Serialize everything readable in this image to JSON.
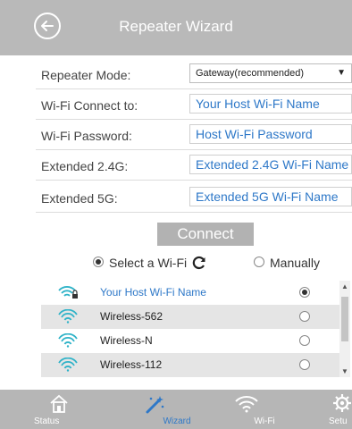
{
  "header": {
    "title": "Repeater Wizard"
  },
  "form": {
    "repeater_mode_label": "Repeater Mode:",
    "repeater_mode_value": "Gateway(recommended)",
    "wifi_connect_label": "Wi-Fi Connect to:",
    "wifi_connect_value": "Your Host Wi-Fi Name",
    "wifi_password_label": "Wi-Fi Password:",
    "wifi_password_value": "Host Wi-Fi Password",
    "ext24_label": "Extended 2.4G:",
    "ext24_value": "Extended 2.4G Wi-Fi Name",
    "ext5_label": "Extended 5G:",
    "ext5_value": "Extended 5G Wi-Fi Name"
  },
  "connect_label": "Connect",
  "mode": {
    "select_label": "Select a Wi-Fi",
    "manual_label": "Manually",
    "selected": "select"
  },
  "wifi_list": [
    {
      "ssid": "Your Host Wi-Fi Name",
      "selected": true,
      "locked": true
    },
    {
      "ssid": "Wireless-562",
      "selected": false,
      "locked": false
    },
    {
      "ssid": "Wireless-N",
      "selected": false,
      "locked": false
    },
    {
      "ssid": "Wireless-112",
      "selected": false,
      "locked": false
    }
  ],
  "nav": {
    "status": "Status",
    "wizard": "Wizard",
    "wifi": "Wi-Fi",
    "setup": "Setu"
  },
  "colors": {
    "accent": "#2e78c8",
    "header": "#b9b9b9",
    "nav": "#b6b6b6"
  }
}
